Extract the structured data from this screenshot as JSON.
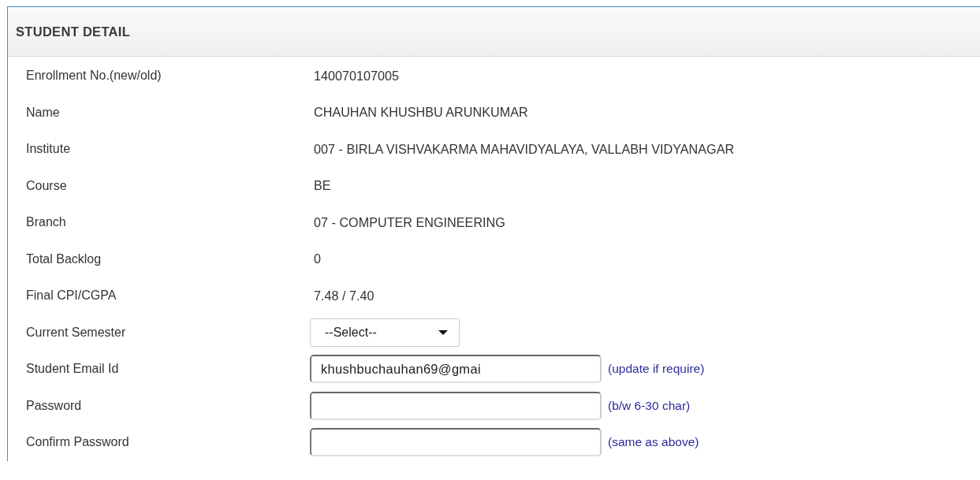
{
  "panel": {
    "title": "STUDENT DETAIL"
  },
  "rows": [
    {
      "label": "Enrollment No.(new/old)",
      "kind": "text",
      "value": "140070107005"
    },
    {
      "label": "Name",
      "kind": "text",
      "value": "CHAUHAN KHUSHBU ARUNKUMAR"
    },
    {
      "label": "Institute",
      "kind": "text",
      "value": "007 - BIRLA VISHVAKARMA MAHAVIDYALAYA, VALLABH VIDYANAGAR"
    },
    {
      "label": "Course",
      "kind": "text",
      "value": "BE"
    },
    {
      "label": "Branch",
      "kind": "text",
      "value": "07 - COMPUTER ENGINEERING"
    },
    {
      "label": "Total Backlog",
      "kind": "text",
      "value": "0"
    },
    {
      "label": "Final CPI/CGPA",
      "kind": "text",
      "value": "7.48 / 7.40"
    },
    {
      "label": "Current Semester",
      "kind": "select",
      "value": "--Select--"
    },
    {
      "label": "Student Email Id",
      "kind": "input",
      "value": "khushbuchauhan69@gmai",
      "hint": "(update if require)"
    },
    {
      "label": "Password",
      "kind": "input",
      "value": "",
      "hint": "(b/w 6-30 char)"
    },
    {
      "label": "Confirm Password",
      "kind": "input",
      "value": "",
      "hint": "(same as above)"
    }
  ]
}
